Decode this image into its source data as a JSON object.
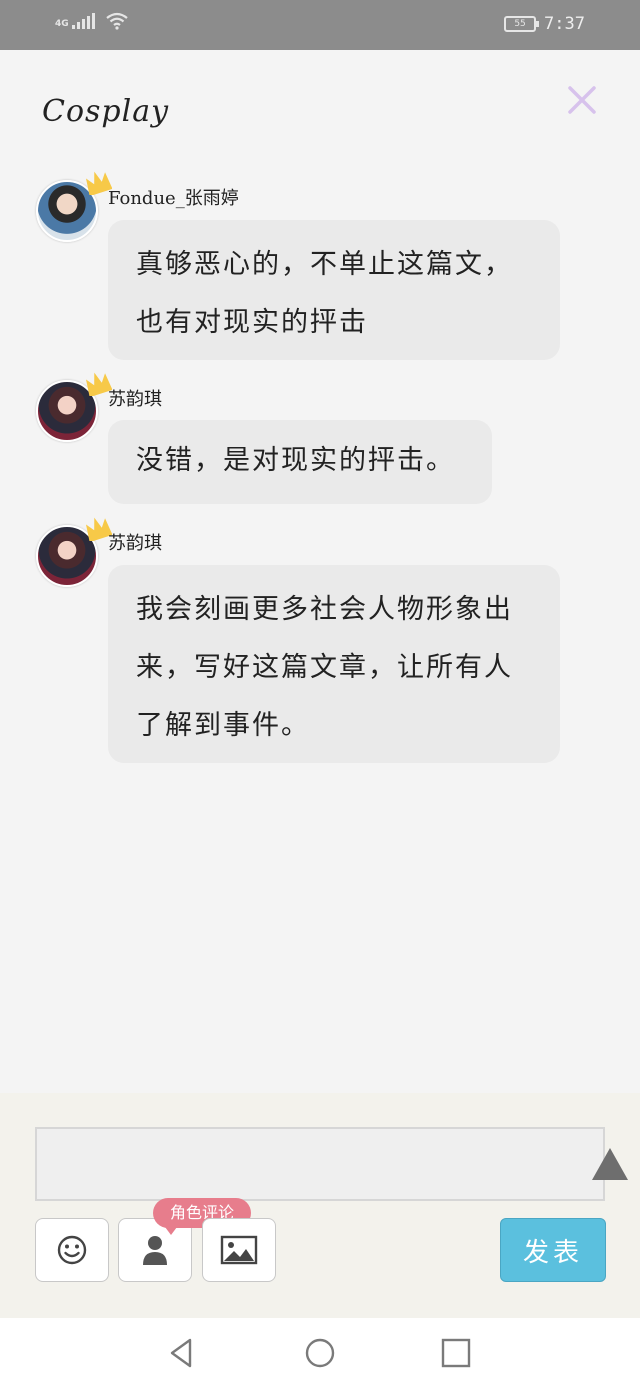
{
  "status_bar": {
    "network": "4G",
    "battery": "55",
    "time": "7:37"
  },
  "header": {
    "title": "Cosplay",
    "close_icon": "close-icon"
  },
  "messages": [
    {
      "username": "Fondue_张雨婷",
      "lines": [
        "真够恶心的，不单止这篇文，",
        "也有对现实的抨击"
      ]
    },
    {
      "username": "苏韵琪",
      "lines": [
        "没错，是对现实的抨击。"
      ]
    },
    {
      "username": "苏韵琪",
      "lines": [
        "我会刻画更多社会人物形象出",
        "来，写好这篇文章，让所有人",
        "了解到事件。"
      ]
    }
  ],
  "composer": {
    "input_value": "",
    "role_tag": "角色评论",
    "send_label": "发表",
    "icons": [
      "emoji-icon",
      "person-icon",
      "image-icon"
    ]
  },
  "colors": {
    "accent": "#5bc0de",
    "role_tag": "#e77d8c",
    "close": "#d7c2ec",
    "crown": "#f7c948"
  }
}
